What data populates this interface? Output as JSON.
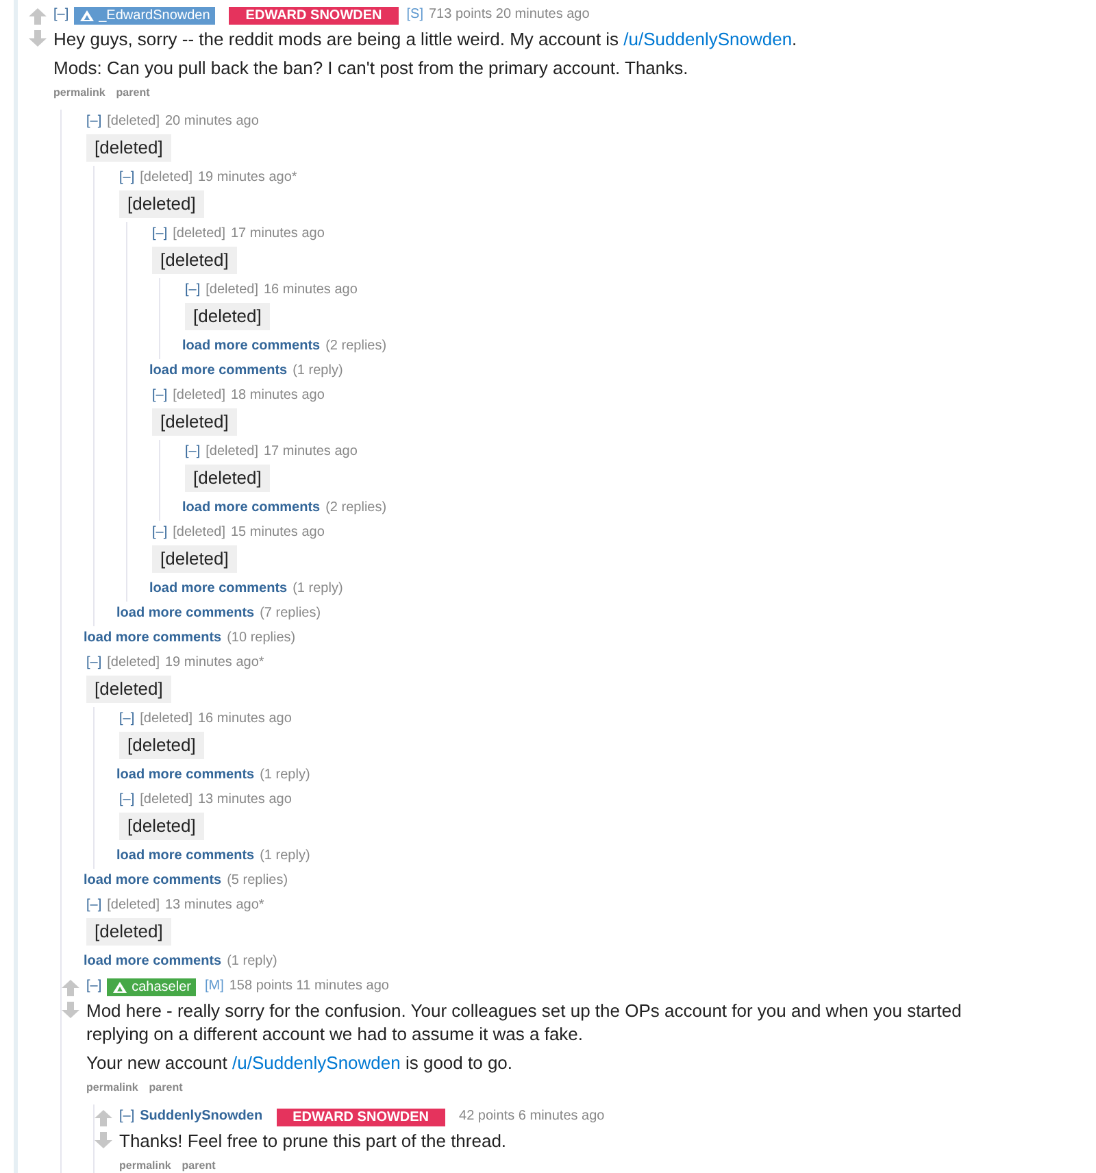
{
  "comments": [
    {
      "kind": "comment",
      "collapse": "[–]",
      "author": "_EdwardSnowden",
      "color": "#5f99cf",
      "flair": "EDWARD SNOWDEN",
      "tag": "[S]",
      "points": "713 points",
      "time": "20 minutes ago",
      "paragraphs": [
        [
          {
            "text": "Hey guys, sorry -- the reddit mods are being a little weird. My account is "
          },
          {
            "link": "/u/SuddenlySnowden"
          },
          {
            "text": "."
          }
        ],
        [
          {
            "text": "Mods: Can you pull back the ban? I can't post from the primary account. Thanks."
          }
        ]
      ],
      "actions": [
        "permalink",
        "parent"
      ],
      "children": [
        {
          "kind": "deleted",
          "collapse": "[–]",
          "author": "[deleted]",
          "time": "20 minutes ago",
          "body": "[deleted]",
          "children": [
            {
              "kind": "deleted",
              "collapse": "[–]",
              "author": "[deleted]",
              "time": "19 minutes ago*",
              "body": "[deleted]",
              "children": [
                {
                  "kind": "deleted",
                  "collapse": "[–]",
                  "author": "[deleted]",
                  "time": "17 minutes ago",
                  "body": "[deleted]",
                  "children": [
                    {
                      "kind": "deleted",
                      "collapse": "[–]",
                      "author": "[deleted]",
                      "time": "16 minutes ago",
                      "body": "[deleted]"
                    },
                    {
                      "kind": "more",
                      "label": "load more comments",
                      "count": "(2 replies)"
                    }
                  ]
                },
                {
                  "kind": "more",
                  "label": "load more comments",
                  "count": "(1 reply)"
                },
                {
                  "kind": "deleted",
                  "collapse": "[–]",
                  "author": "[deleted]",
                  "time": "18 minutes ago",
                  "body": "[deleted]",
                  "children": [
                    {
                      "kind": "deleted",
                      "collapse": "[–]",
                      "author": "[deleted]",
                      "time": "17 minutes ago",
                      "body": "[deleted]"
                    },
                    {
                      "kind": "more",
                      "label": "load more comments",
                      "count": "(2 replies)"
                    }
                  ]
                },
                {
                  "kind": "deleted",
                  "collapse": "[–]",
                  "author": "[deleted]",
                  "time": "15 minutes ago",
                  "body": "[deleted]"
                },
                {
                  "kind": "more",
                  "label": "load more comments",
                  "count": "(1 reply)"
                }
              ]
            },
            {
              "kind": "more",
              "label": "load more comments",
              "count": "(7 replies)"
            }
          ]
        },
        {
          "kind": "more",
          "label": "load more comments",
          "count": "(10 replies)"
        },
        {
          "kind": "deleted",
          "collapse": "[–]",
          "author": "[deleted]",
          "time": "19 minutes ago*",
          "body": "[deleted]",
          "children": [
            {
              "kind": "deleted",
              "collapse": "[–]",
              "author": "[deleted]",
              "time": "16 minutes ago",
              "body": "[deleted]"
            },
            {
              "kind": "more",
              "label": "load more comments",
              "count": "(1 reply)"
            },
            {
              "kind": "deleted",
              "collapse": "[–]",
              "author": "[deleted]",
              "time": "13 minutes ago",
              "body": "[deleted]"
            },
            {
              "kind": "more",
              "label": "load more comments",
              "count": "(1 reply)"
            }
          ]
        },
        {
          "kind": "more",
          "label": "load more comments",
          "count": "(5 replies)"
        },
        {
          "kind": "deleted",
          "collapse": "[–]",
          "author": "[deleted]",
          "time": "13 minutes ago*",
          "body": "[deleted]"
        },
        {
          "kind": "more",
          "label": "load more comments",
          "count": "(1 reply)"
        },
        {
          "kind": "comment",
          "collapse": "[–]",
          "author": "cahaseler",
          "color": "#46a847",
          "tag": "[M]",
          "points": "158 points",
          "time": "11 minutes ago",
          "paragraphs": [
            [
              {
                "text": "Mod here - really sorry for the confusion. Your colleagues set up the OPs account for you and when you started replying on a different account we had to assume it was a fake."
              }
            ],
            [
              {
                "text": "Your new account "
              },
              {
                "link": "/u/SuddenlySnowden"
              },
              {
                "text": " is good to go."
              }
            ]
          ],
          "actions": [
            "permalink",
            "parent"
          ],
          "children": [
            {
              "kind": "comment",
              "collapse": "[–]",
              "author": "SuddenlySnowden",
              "flair": "EDWARD SNOWDEN",
              "points": "42 points",
              "time": "6 minutes ago",
              "paragraphs": [
                [
                  {
                    "text": "Thanks! Feel free to prune this part of the thread."
                  }
                ]
              ],
              "actions": [
                "permalink",
                "parent"
              ]
            }
          ]
        }
      ]
    }
  ]
}
